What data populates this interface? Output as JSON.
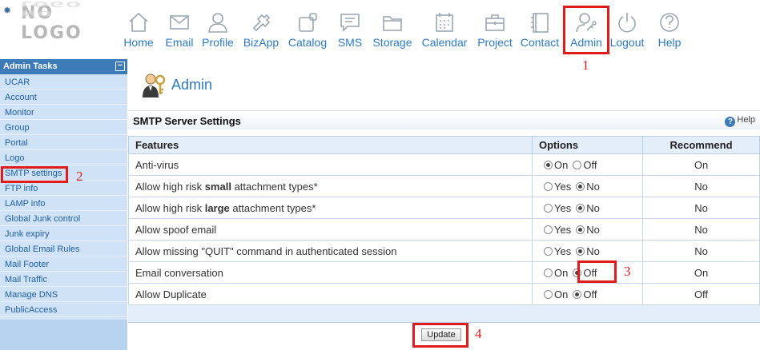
{
  "logo": {
    "text": "NO LOGO"
  },
  "nav": [
    {
      "label": "Home",
      "icon": "home-icon"
    },
    {
      "label": "Email",
      "icon": "envelope-icon"
    },
    {
      "label": "Profile",
      "icon": "user-icon"
    },
    {
      "label": "BizApp",
      "icon": "puzzle-icon"
    },
    {
      "label": "Catalog",
      "icon": "catalog-icon"
    },
    {
      "label": "SMS",
      "icon": "chat-icon"
    },
    {
      "label": "Storage",
      "icon": "folder-icon"
    },
    {
      "label": "Calendar",
      "icon": "calendar-icon"
    },
    {
      "label": "Project",
      "icon": "briefcase-icon"
    },
    {
      "label": "Contact",
      "icon": "address-book-icon"
    },
    {
      "label": "Admin",
      "icon": "admin-key-icon"
    },
    {
      "label": "Logout",
      "icon": "power-icon"
    },
    {
      "label": "Help",
      "icon": "help-icon"
    }
  ],
  "sidebar": {
    "title": "Admin Tasks",
    "toggle": "−",
    "items": [
      "UCAR",
      "Account",
      "Monitor",
      "Group",
      "Portal",
      "Logo",
      "SMTP settings",
      "FTP info",
      "LAMP info",
      "Global Junk control",
      "Junk expiry",
      "Global Email Rules",
      "Mail Footer",
      "Mail Traffic",
      "Manage DNS",
      "PublicAccess"
    ]
  },
  "main": {
    "page_title": "Admin",
    "section_title": "SMTP Server Settings",
    "help_label": "Help",
    "table": {
      "headers": [
        "Features",
        "Options",
        "Recommend"
      ],
      "rows": [
        {
          "pre": "Anti-virus",
          "bold": "",
          "post": "",
          "opt1": "On",
          "opt2": "Off",
          "selected": 1,
          "rec": "On"
        },
        {
          "pre": "Allow high risk ",
          "bold": "small",
          "post": " attachment types*",
          "opt1": "Yes",
          "opt2": "No",
          "selected": 2,
          "rec": "No"
        },
        {
          "pre": "Allow high risk ",
          "bold": "large",
          "post": " attachment types*",
          "opt1": "Yes",
          "opt2": "No",
          "selected": 2,
          "rec": "No"
        },
        {
          "pre": "Allow spoof email",
          "bold": "",
          "post": "",
          "opt1": "Yes",
          "opt2": "No",
          "selected": 2,
          "rec": "No"
        },
        {
          "pre": "Allow missing \"QUIT\" command in authenticated session",
          "bold": "",
          "post": "",
          "opt1": "Yes",
          "opt2": "No",
          "selected": 2,
          "rec": "No"
        },
        {
          "pre": "Email conversation",
          "bold": "",
          "post": "",
          "opt1": "On",
          "opt2": "Off",
          "selected": 2,
          "rec": "On"
        },
        {
          "pre": "Allow Duplicate",
          "bold": "",
          "post": "",
          "opt1": "On",
          "opt2": "Off",
          "selected": 2,
          "rec": "Off"
        }
      ]
    },
    "update_label": "Update"
  },
  "annotations": [
    "1",
    "2",
    "3",
    "4"
  ],
  "colors": {
    "accent": "#2e79c4",
    "sidebar_bg": "#cfe2f6",
    "highlight": "#e01b1b"
  }
}
